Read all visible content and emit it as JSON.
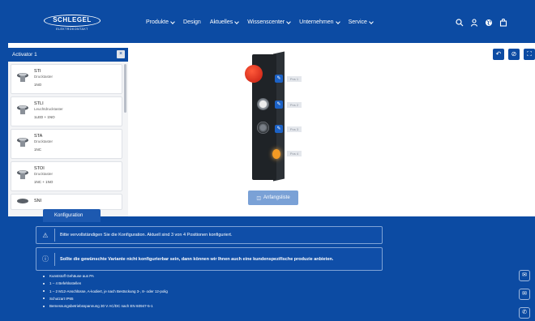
{
  "brand": {
    "name": "SCHLEGEL",
    "tagline": "ELEKTROKONTAKT"
  },
  "nav": [
    {
      "label": "Produkte",
      "has_menu": true
    },
    {
      "label": "Design",
      "has_menu": false
    },
    {
      "label": "Aktuelles",
      "has_menu": true
    },
    {
      "label": "Wissenscenter",
      "has_menu": true
    },
    {
      "label": "Unternehmen",
      "has_menu": true
    },
    {
      "label": "Service",
      "has_menu": true
    }
  ],
  "header_icons": [
    "search-icon",
    "user-icon",
    "globe-icon",
    "cart-icon"
  ],
  "panel": {
    "title": "Activator 1",
    "close_label": "×",
    "items": [
      {
        "name": "STI",
        "type": "Drucktaster",
        "code": "1NO"
      },
      {
        "name": "STLI",
        "type": "Leuchtdrucktaster",
        "code": "1LED + 1NO"
      },
      {
        "name": "STA",
        "type": "Drucktaster",
        "code": "1NC"
      },
      {
        "name": "STOI",
        "type": "Drucktaster",
        "code": "1NC + 1NO"
      },
      {
        "name": "SNI",
        "type": "",
        "code": ""
      }
    ]
  },
  "toolbar": [
    "undo-icon",
    "hide-icon",
    "fullscreen-icon"
  ],
  "device": {
    "positions": [
      "Pos 1",
      "Pos 2",
      "Pos 3",
      "Pos 4"
    ],
    "view_button_label": "Anfangsliste"
  },
  "tab_label": "Konfiguration",
  "notices": [
    {
      "icon": "warning-icon",
      "text": "Bitte vervollständigen Sie die Konfiguration. Aktuell sind 3 von 4 Positionen konfiguriert.",
      "bold": false
    },
    {
      "icon": "info-icon",
      "text": "Sollte die gewünschte Variante nicht konfigurierbar sein, dann können wir Ihnen auch eine kundenspezifische produzie anbieten.",
      "bold": true
    }
  ],
  "features": [
    "Kunststoff Gehäuse aus PA",
    "1 – 4 Befehlsstellen",
    "1 – 2 M12-Anschlüsse, A-kodiert, je nach Bestückung 3-, 8- oder 12-polig",
    "Schutzart IP65",
    "Bemessungsbetriebsspannung 30 V AC/DC nach EN 60947-5-1"
  ],
  "side_buttons": [
    "chat-icon",
    "mail-icon",
    "phone-icon"
  ],
  "colors": {
    "brand": "#0c4ba3",
    "accent": "#1c62c6",
    "view_button": "#7aa1d6"
  }
}
